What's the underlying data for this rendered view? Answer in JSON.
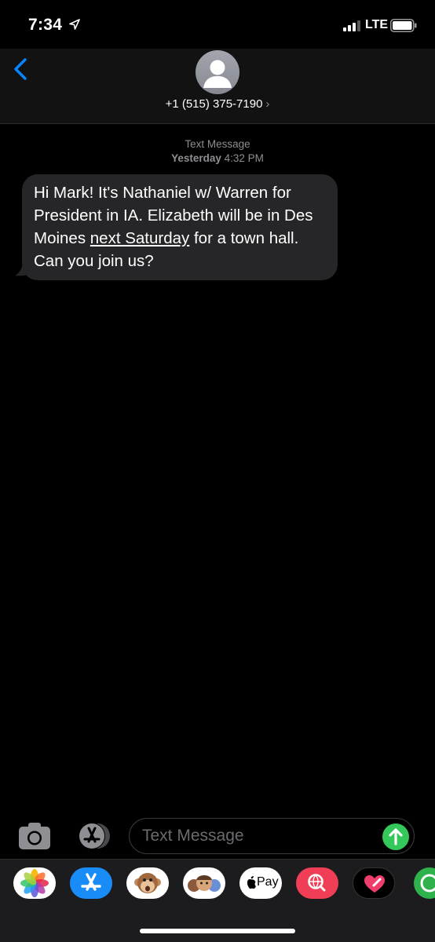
{
  "status_bar": {
    "time": "7:34",
    "carrier": "LTE"
  },
  "header": {
    "contact": "+1 (515) 375-7190",
    "chevron": "›"
  },
  "conversation": {
    "service": "Text Message",
    "date_day": "Yesterday",
    "date_time": "4:32 PM",
    "message": {
      "part1": "Hi Mark! It's Nathaniel w/ Warren for President in IA. Elizabeth will be in Des Moines ",
      "link": "next Saturday",
      "part2": " for a town hall. Can you join us?"
    }
  },
  "composer": {
    "placeholder": "Text Message"
  },
  "app_drawer": {
    "apple_pay_label": "Pay",
    "apps": [
      "photos-icon",
      "app-store-icon",
      "animoji-icon",
      "memoji-icon",
      "apple-pay-icon",
      "web-search-icon",
      "digital-touch-icon",
      "partial-app-icon"
    ]
  },
  "colors": {
    "bubble": "#262628",
    "accent_blue": "#0a84ff",
    "send_green": "#34c759"
  }
}
